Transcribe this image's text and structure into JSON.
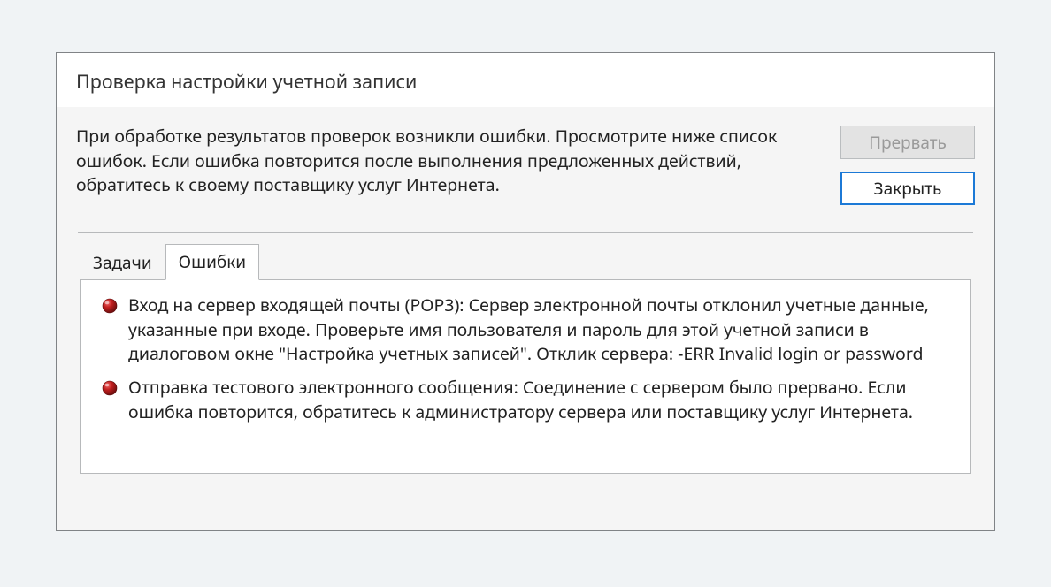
{
  "dialog": {
    "title": "Проверка настройки учетной записи",
    "message": "При обработке результатов проверок возникли ошибки. Просмотрите ниже список ошибок. Если ошибка повторится после выполнения предложенных действий, обратитесь к своему поставщику услуг Интернета.",
    "buttons": {
      "abort": "Прервать",
      "close": "Закрыть"
    },
    "tabs": {
      "tasks": "Задачи",
      "errors": "Ошибки"
    },
    "errors": [
      "Вход на сервер входящей почты (POP3): Сервер электронной почты отклонил учетные данные, указанные при входе. Проверьте имя пользователя и пароль для этой учетной записи в диалоговом окне \"Настройка учетных записей\".  Отклик сервера: -ERR Invalid login or password",
      "Отправка тестового электронного сообщения: Соединение с сервером было прервано. Если ошибка повторится, обратитесь к администратору сервера или поставщику услуг Интернета."
    ]
  },
  "colors": {
    "accent": "#1c79d6",
    "error": "#b11b1b"
  }
}
